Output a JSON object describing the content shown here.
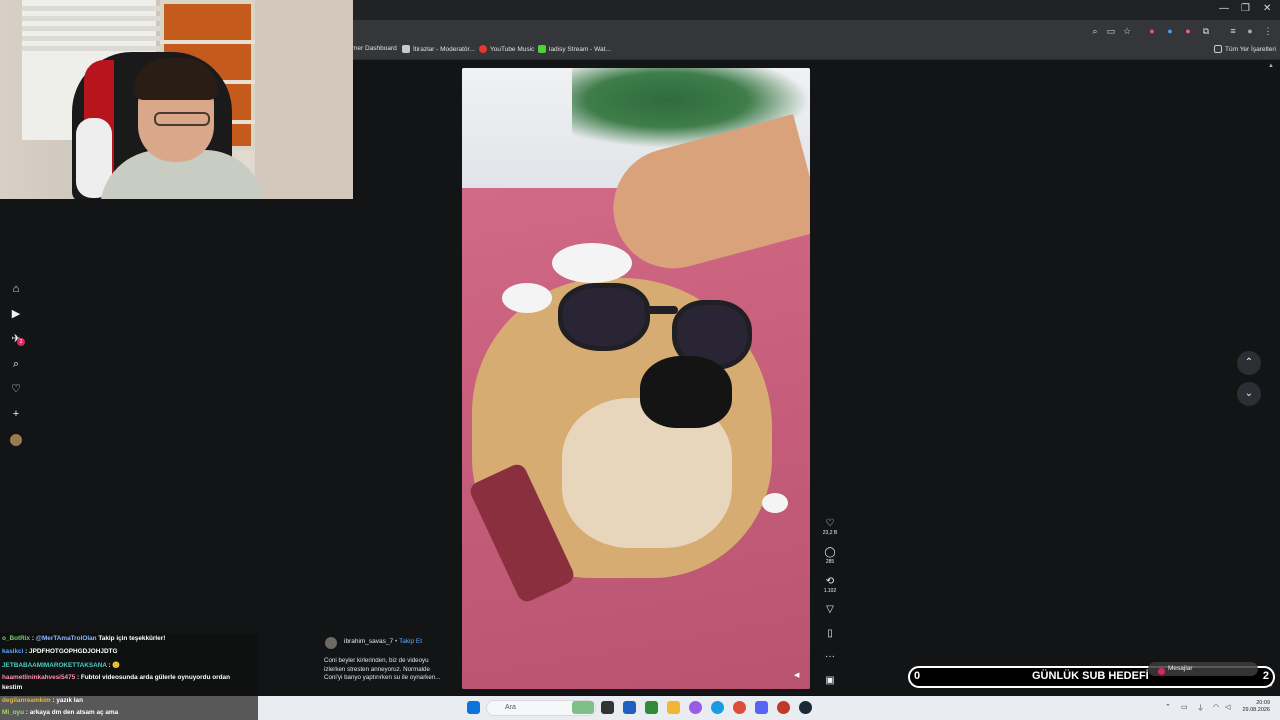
{
  "bookmarks": [
    {
      "label": "mer Dashboard",
      "color": "#3a3b3f"
    },
    {
      "label": "İtirazlar - Moderatör...",
      "color": "#c9c9c9"
    },
    {
      "label": "YouTube Music",
      "color": "#e5372b"
    },
    {
      "label": "ladisy Stream - Wat...",
      "color": "#4fd13a"
    }
  ],
  "all_bookmarks_label": "Tüm Yer İşaretleri",
  "post": {
    "username": "ibrahim_savas_7",
    "separator": "•",
    "follow_label": "Takip Et",
    "caption": "Coni beyler kirlerinden, biz de videoyu izlerken stresten anneyoruz. Normalde Coni'yi banyo yaptırırken su ile oynarken..."
  },
  "actions": {
    "likes": "23,2 B",
    "comments": "285",
    "reposts": "1.102"
  },
  "sidebar": {
    "notification_count": "2"
  },
  "chat": [
    {
      "user": "o_BotRix",
      "sep": " : ",
      "mention": "@MerTAmaTrolOlan",
      "msg": " Takip için teşekkürler!",
      "cls": "u1"
    },
    {
      "user": "kasikci",
      "sep": " : ",
      "mention": "",
      "msg": "JPDFHOTGOPHGDJOHJDTG",
      "cls": "u2"
    },
    {
      "user": "JETBABAAMIMAROKETTAKSANA",
      "sep": " : ",
      "mention": "",
      "msg": "🙂",
      "cls": "u4"
    },
    {
      "user": "haametlininkahvesi5475",
      "sep": " : ",
      "mention": "",
      "msg": "Fubtol videosunda arda gülerle oynuyordu ordan kestim",
      "cls": "u5"
    },
    {
      "user": "degilanreamkim",
      "sep": " : ",
      "mention": "",
      "msg": "yazık lan",
      "cls": "u6"
    },
    {
      "user": "Ml_oyu",
      "sep": " : ",
      "mention": "",
      "msg": "arkaya dm den atsam aç ama",
      "cls": "u7"
    }
  ],
  "sub_goal": {
    "current": "0",
    "title": "GÜNLÜK SUB HEDEFİ",
    "target": "2"
  },
  "messages_label": "Mesajlar",
  "taskbar": {
    "search_placeholder": "Ara",
    "time": "20:09",
    "date": "29.08.2026"
  }
}
